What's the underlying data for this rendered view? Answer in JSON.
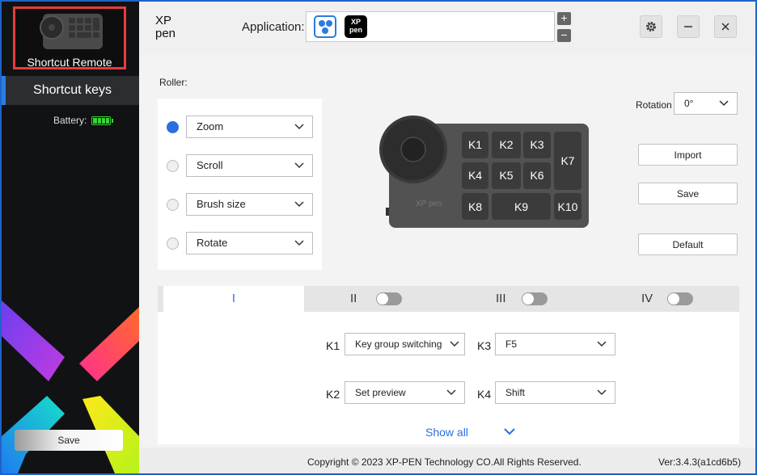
{
  "sidebar": {
    "device_name": "Shortcut Remote",
    "nav_item": "Shortcut keys",
    "battery_label": "Battery:",
    "save_label": "Save"
  },
  "header": {
    "application_label": "Application:",
    "brand_logo": "XP-PEN logo",
    "add_symbol": "+",
    "remove_symbol": "−",
    "app_icon_2_text": "XP pen",
    "icons": [
      "settings-icon",
      "minimize-icon",
      "close-icon"
    ]
  },
  "roller": {
    "title": "Roller:",
    "options": [
      {
        "label": "Zoom",
        "selected": true
      },
      {
        "label": "Scroll",
        "selected": false
      },
      {
        "label": "Brush size",
        "selected": false
      },
      {
        "label": "Rotate",
        "selected": false
      }
    ]
  },
  "device_keys": [
    "K1",
    "K2",
    "K3",
    "K4",
    "K5",
    "K6",
    "K7",
    "K8",
    "K9",
    "K10"
  ],
  "device_brand": "XP pen",
  "rotation": {
    "label": "Rotation",
    "value": "0°"
  },
  "actions": {
    "import": "Import",
    "save": "Save",
    "default": "Default"
  },
  "tabs": [
    {
      "label": "I",
      "active": true
    },
    {
      "label": "II",
      "toggle_on": false
    },
    {
      "label": "III",
      "toggle_on": false
    },
    {
      "label": "IV",
      "toggle_on": false
    }
  ],
  "key_assignments": [
    {
      "key": "K1",
      "value": "Key group switching"
    },
    {
      "key": "K3",
      "value": "F5"
    },
    {
      "key": "K2",
      "value": "Set preview"
    },
    {
      "key": "K4",
      "value": "Shift"
    }
  ],
  "show_all": "Show all",
  "footer": {
    "copyright": "Copyright © 2023  XP-PEN Technology CO.All Rights Reserved.",
    "version": "Ver:3.4.3(a1cd6b5)"
  },
  "colors": {
    "accent": "#2a6fe0",
    "sidebar_bg": "#111214",
    "highlight": "#e63c3c",
    "battery": "#3ad13a"
  }
}
